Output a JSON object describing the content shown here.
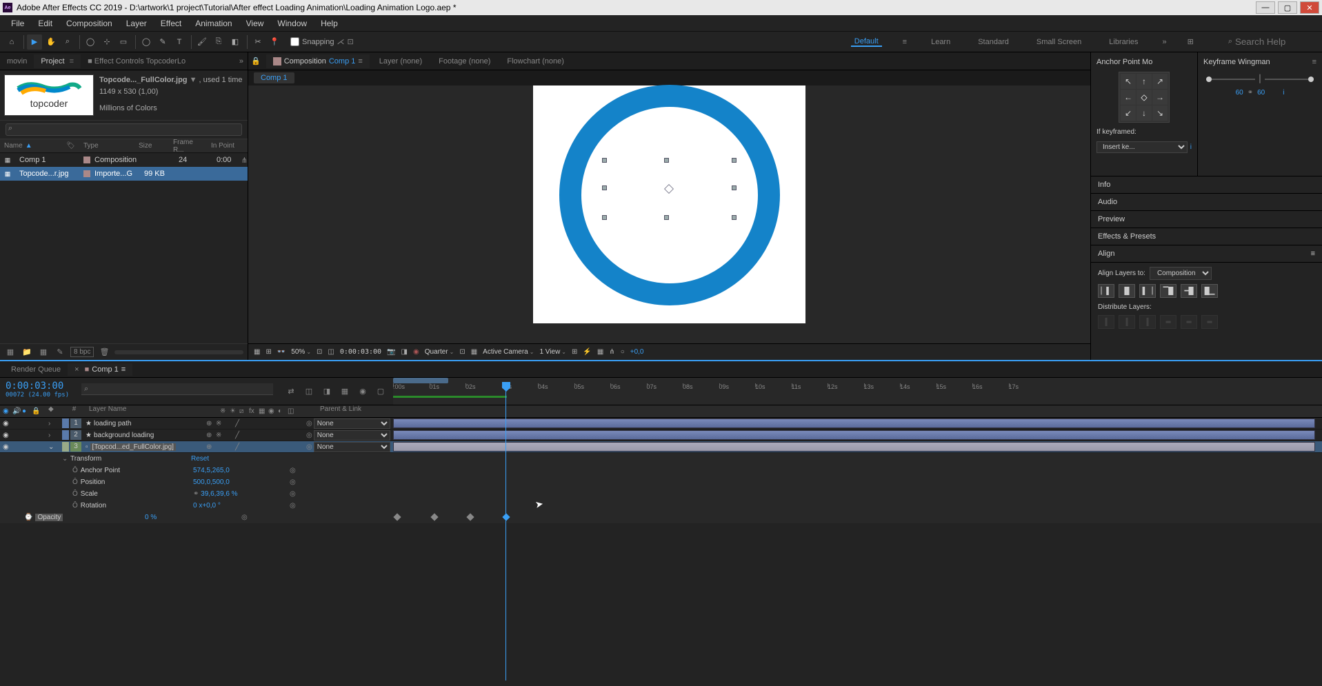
{
  "title": "Adobe After Effects CC 2019 - D:\\artwork\\1 project\\Tutorial\\After effect Loading Animation\\Loading Animation Logo.aep *",
  "icon_text": "Ae",
  "menu": [
    "File",
    "Edit",
    "Composition",
    "Layer",
    "Effect",
    "Animation",
    "View",
    "Window",
    "Help"
  ],
  "snapping": "Snapping",
  "workspaces": [
    "Default",
    "Learn",
    "Standard",
    "Small Screen",
    "Libraries"
  ],
  "search_placeholder": "Search Help",
  "project": {
    "tabs": {
      "movin": "movin",
      "project": "Project",
      "ec": "Effect Controls TopcoderLo"
    },
    "thumb_label": "topcoder",
    "asset_name": "Topcode..._FullColor.jpg",
    "asset_meta": ", used 1 time",
    "asset_dims": "1149 x 530 (1,00)",
    "colors_info": "Millions of Colors",
    "cols": {
      "name": "Name",
      "type": "Type",
      "size": "Size",
      "fr": "Frame R...",
      "ip": "In Point"
    },
    "rows": [
      {
        "name": "Comp 1",
        "type": "Composition",
        "size": "",
        "fr": "24",
        "ip": "0:00"
      },
      {
        "name": "Topcode...r.jpg",
        "type": "Importe...G",
        "size": "99 KB",
        "fr": "",
        "ip": ""
      }
    ],
    "bpc": "8 bpc"
  },
  "viewer": {
    "tabs": {
      "comp_prefix": "Composition ",
      "comp_name": "Comp 1",
      "layer": "Layer (none)",
      "footage": "Footage (none)",
      "flowchart": "Flowchart (none)"
    },
    "subtab": "Comp 1",
    "footer": {
      "mag": "50%",
      "time": "0:00:03:00",
      "res": "Quarter",
      "cam": "Active Camera",
      "view": "1 View",
      "exp": "+0,0"
    }
  },
  "right": {
    "anchor_title": "Anchor Point Mo",
    "wingman_title": "Keyframe Wingman",
    "wingman_val1": "60",
    "wingman_val2": "60",
    "if_keyframed": "If keyframed:",
    "insert": "Insert ke...",
    "panels": [
      "Info",
      "Audio",
      "Preview",
      "Effects & Presets"
    ],
    "align_title": "Align",
    "align_to": "Align Layers to:",
    "align_target": "Composition",
    "distribute": "Distribute Layers:"
  },
  "timeline": {
    "tabs": {
      "rq": "Render Queue",
      "comp": "Comp 1"
    },
    "timecode": "0:00:03:00",
    "timecode_sub": "00072 (24.00 fps)",
    "ruler": [
      ":00s",
      "01s",
      "02s",
      "03s",
      "04s",
      "05s",
      "06s",
      "07s",
      "08s",
      "09s",
      "10s",
      "11s",
      "12s",
      "13s",
      "14s",
      "15s",
      "16s",
      "17s"
    ],
    "cols": {
      "num": "#",
      "name": "Layer Name",
      "parent": "Parent & Link"
    },
    "layers": [
      {
        "num": "1",
        "name": "loading path",
        "parent": "None"
      },
      {
        "num": "2",
        "name": "background loading",
        "parent": "None"
      },
      {
        "num": "3",
        "name": "[Topcod...ed_FullColor.jpg]",
        "parent": "None"
      }
    ],
    "transform": "Transform",
    "reset": "Reset",
    "props": [
      {
        "name": "Anchor Point",
        "val": "574,5,265,0"
      },
      {
        "name": "Position",
        "val": "500,0,500,0"
      },
      {
        "name": "Scale",
        "val": "39,6,39,6 %"
      },
      {
        "name": "Rotation",
        "val": "0 x+0,0 °"
      },
      {
        "name": "Opacity",
        "val": "0 %"
      }
    ]
  }
}
